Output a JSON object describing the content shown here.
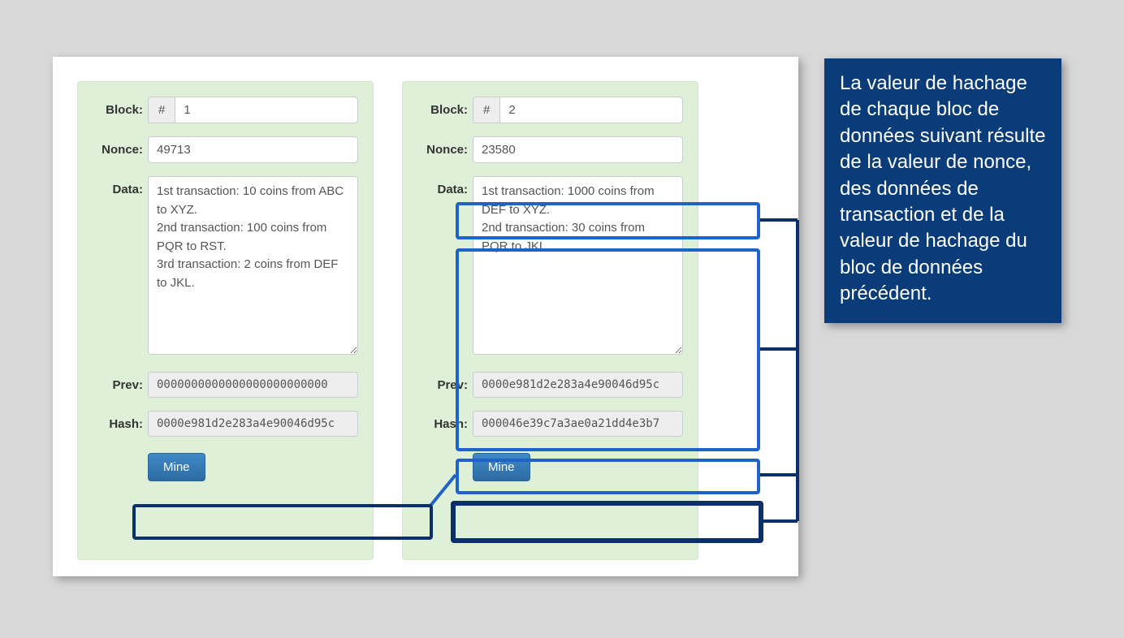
{
  "labels": {
    "block": "Block:",
    "nonce": "Nonce:",
    "data": "Data:",
    "prev": "Prev:",
    "hash": "Hash:",
    "hash_prefix": "#",
    "mine": "Mine"
  },
  "blocks": [
    {
      "number": "1",
      "nonce": "49713",
      "data": "1st transaction: 10 coins from ABC to XYZ.\n2nd transaction: 100 coins from PQR to RST.\n3rd transaction: 2 coins from DEF to JKL.",
      "prev": "0000000000000000000000000",
      "hash": "0000e981d2e283a4e90046d95c"
    },
    {
      "number": "2",
      "nonce": "23580",
      "data": "1st transaction: 1000 coins from DEF to XYZ.\n2nd transaction: 30 coins from PQR to JKL.",
      "prev": "0000e981d2e283a4e90046d95c",
      "hash": "000046e39c7a3ae0a21dd4e3b7"
    }
  ],
  "callout_text": "La valeur de hachage de chaque bloc de données suivant résulte de la valeur de nonce, des données de transaction et de la valeur de hachage du bloc de données précédent."
}
